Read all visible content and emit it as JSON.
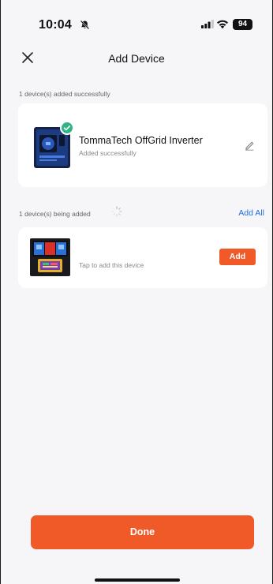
{
  "status_bar": {
    "time": "10:04",
    "battery": "94"
  },
  "header": {
    "title": "Add Device"
  },
  "added_section": {
    "label": "1 device(s) added successfully",
    "device": {
      "name": "TommaTech OffGrid Inverter",
      "status": "Added successfully"
    }
  },
  "adding_section": {
    "label": "1 device(s) being added",
    "add_all_label": "Add All",
    "device": {
      "hint": "Tap to add this device",
      "add_label": "Add"
    }
  },
  "footer": {
    "done_label": "Done"
  },
  "colors": {
    "accent": "#f05a28",
    "link": "#1e6fe0",
    "success": "#30b487"
  }
}
